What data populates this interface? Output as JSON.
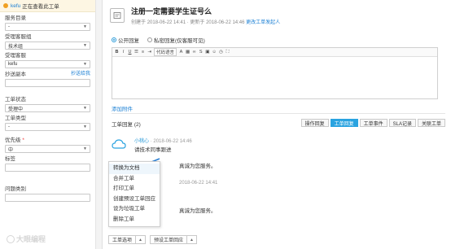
{
  "sidebar": {
    "viewing_user": "kefu",
    "viewing_text": "正在查看此工单",
    "service_directory": {
      "label": "服务目录",
      "value": "-"
    },
    "handler_group": {
      "label": "受理客服组",
      "value": "技术组"
    },
    "handler": {
      "label": "受理客服",
      "value": "kefu"
    },
    "cc": {
      "label": "抄送副本",
      "link": "抄送给我"
    },
    "status": {
      "label": "工单状态",
      "value": "受理中"
    },
    "type": {
      "label": "工单类型",
      "value": "-"
    },
    "priority": {
      "label": "优先级",
      "required": "*",
      "value": "中"
    },
    "tags": {
      "label": "标签"
    },
    "category": {
      "label": "问题类别"
    }
  },
  "ticket": {
    "title": "注册一定需要学生证号么",
    "created_label": "创建于",
    "created": "2018-06-22 14:41",
    "updated_label": "更新于",
    "updated": "2018-06-22 14:46",
    "more_link": "更改工单发起人"
  },
  "reply_mode": {
    "public": "公开回复",
    "private": "私密回复(仅客服可见)"
  },
  "toolbar": {
    "bold": "B",
    "italic": "I",
    "underline": "U",
    "code_select": "代码语言"
  },
  "attach_label": "添加附件",
  "replies": {
    "title": "工单回复",
    "count": "(2)",
    "tabs": [
      "操作回复",
      "工单回复",
      "工单事件",
      "SLA记录",
      "关联工单"
    ]
  },
  "messages": [
    {
      "name": "小桃心",
      "time": "2018-06-22 14:46",
      "body": "请技术同事跟进"
    },
    {
      "partial": "真诚为您服务。"
    },
    {
      "partial_time": "2018-06-22 14:41"
    },
    {
      "partial": "真诚为您服务。"
    }
  ],
  "context_menu": [
    "转换为文档",
    "合并工单",
    "打印工单",
    "创建预设工单回应",
    "设为垃圾工单",
    "删除工单"
  ],
  "bottom": {
    "options": "工单选项",
    "preset": "预设工单回应"
  },
  "watermark": "大眼编程",
  "colors": {
    "accent": "#2aa3e0",
    "link": "#1a7fd4"
  }
}
